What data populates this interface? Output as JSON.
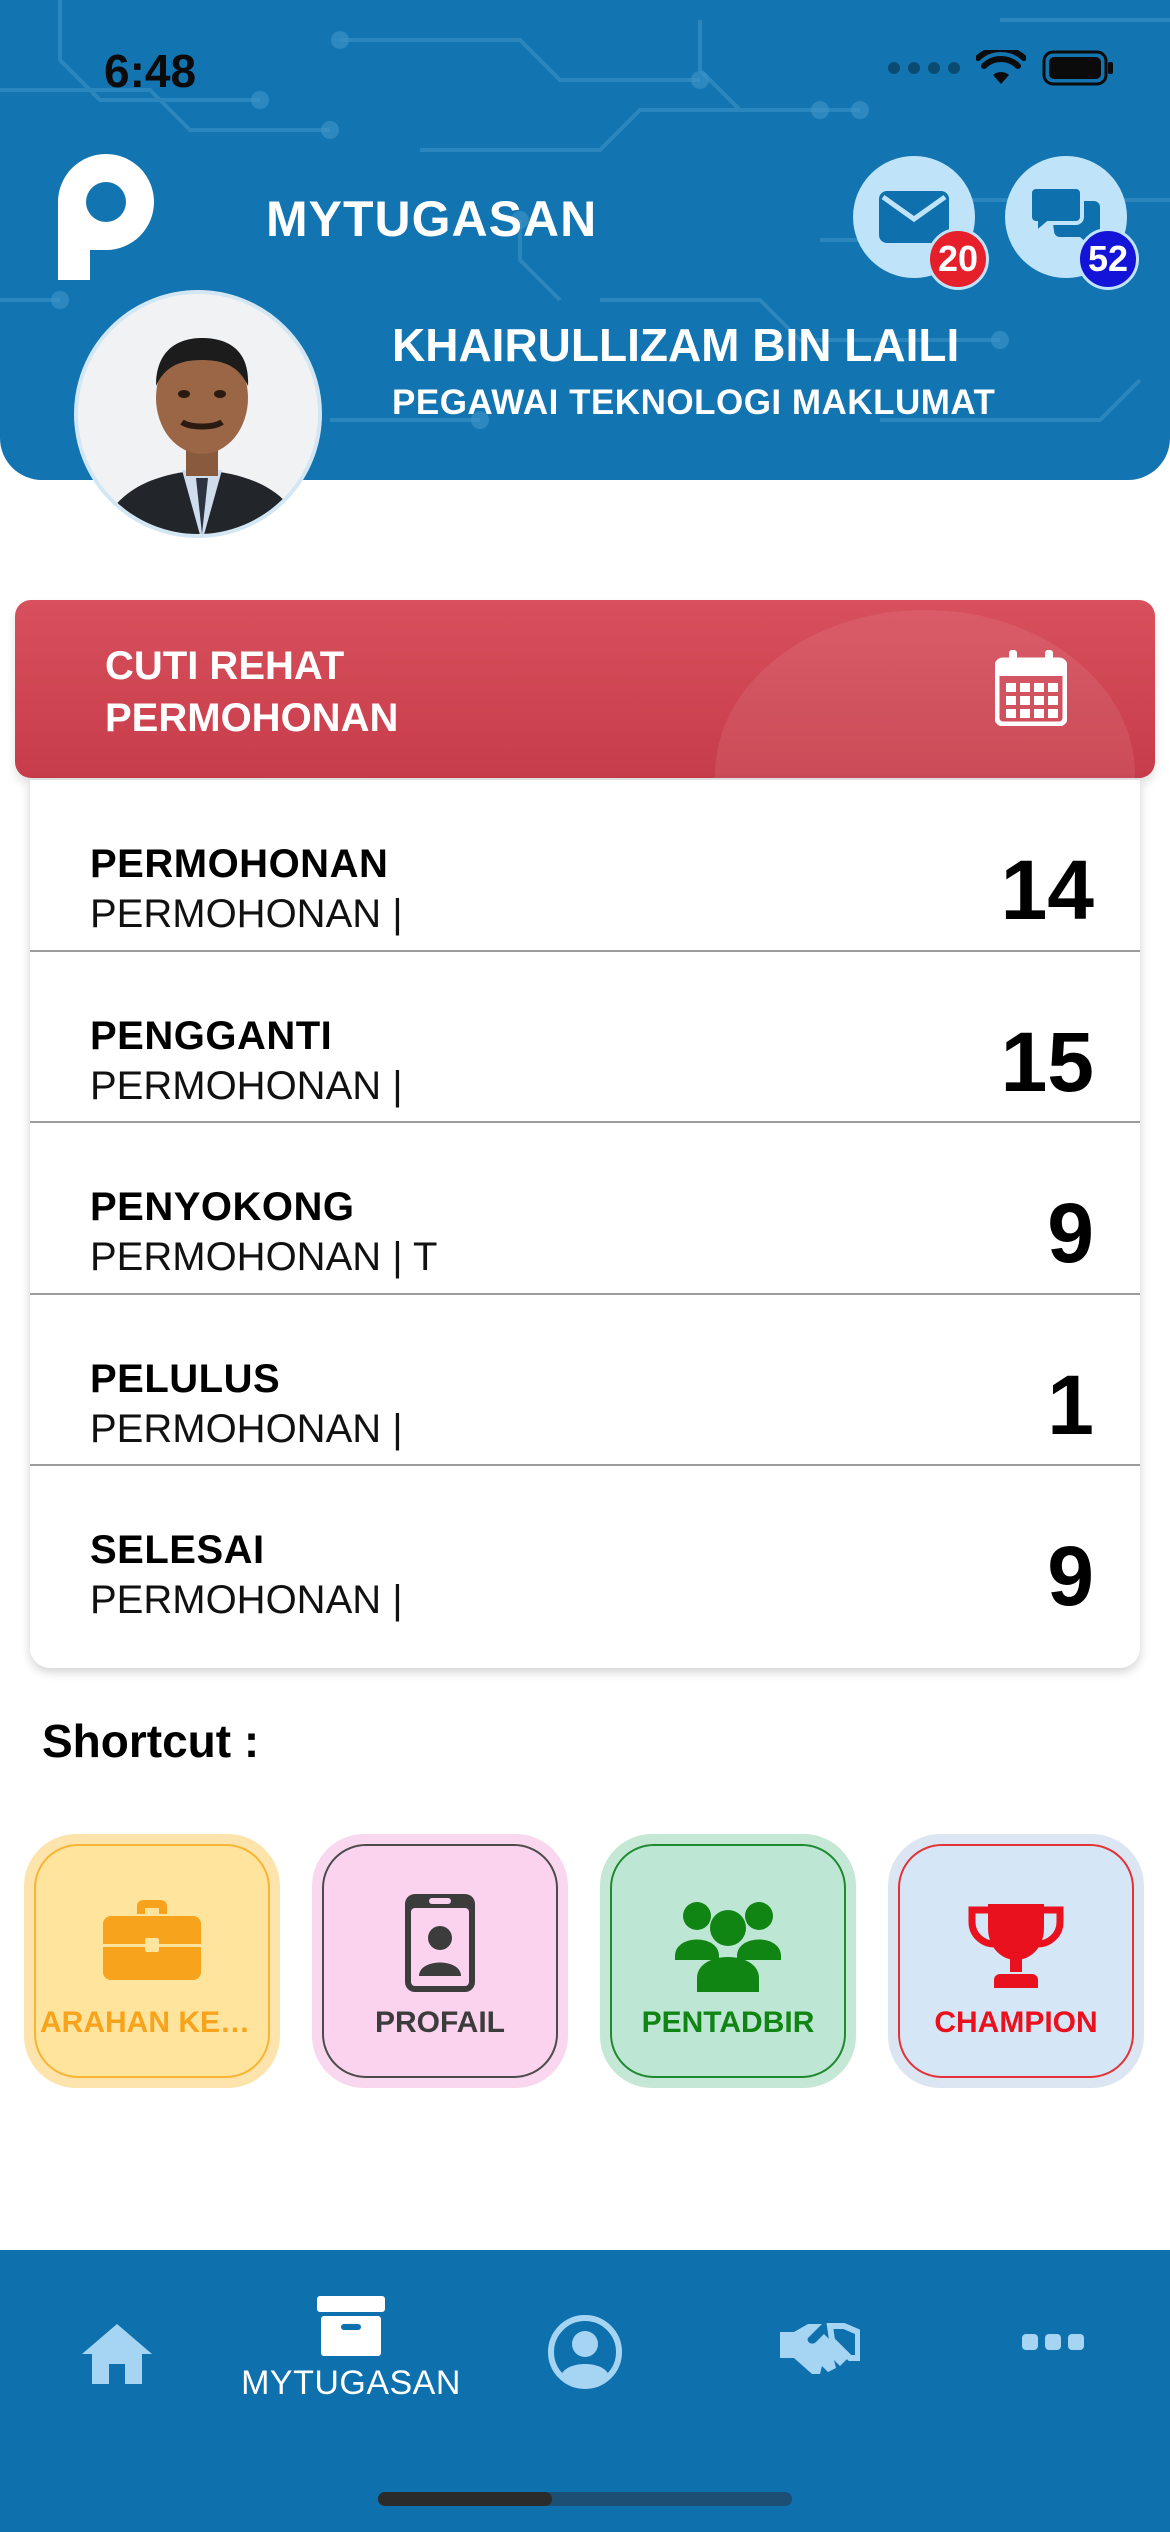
{
  "status_bar": {
    "time": "6:48"
  },
  "header": {
    "app_title": "MYTUGASAN",
    "user_name": "KHAIRULLIZAM BIN LAILI",
    "user_role": "PEGAWAI TEKNOLOGI MAKLUMAT",
    "mail_badge": "20",
    "chat_badge": "52",
    "colors": {
      "background": "#1274b0",
      "badge_red": "#e5202b",
      "badge_blue": "#1414d8"
    }
  },
  "leave_card": {
    "title_line1": "CUTI REHAT",
    "title_line2": "PERMOHONAN",
    "icon": "calendar-icon",
    "header_color": "#cf4653",
    "rows": [
      {
        "title": "PERMOHONAN",
        "subtitle": "PERMOHONAN |",
        "count": "14"
      },
      {
        "title": "PENGGANTI",
        "subtitle": "PERMOHONAN |",
        "count": "15"
      },
      {
        "title": "PENYOKONG",
        "subtitle": "PERMOHONAN | T",
        "count": "9"
      },
      {
        "title": "PELULUS",
        "subtitle": "PERMOHONAN |",
        "count": "1"
      },
      {
        "title": "SELESAI",
        "subtitle": "PERMOHONAN |",
        "count": "9"
      }
    ]
  },
  "shortcuts": {
    "label": "Shortcut :",
    "items": [
      {
        "label": "ARAHAN KER...",
        "icon": "briefcase-icon",
        "color": "#f7a41c"
      },
      {
        "label": "PROFAIL",
        "icon": "id-badge-icon",
        "color": "#3c3c3c"
      },
      {
        "label": "PENTADBIR",
        "icon": "users-icon",
        "color": "#108514"
      },
      {
        "label": "CHAMPION",
        "icon": "trophy-icon",
        "color": "#e8111d"
      }
    ]
  },
  "bottom_nav": {
    "items": [
      {
        "icon": "home-icon"
      },
      {
        "icon": "archive-icon",
        "label": "MYTUGASAN"
      },
      {
        "icon": "user-circle-icon"
      },
      {
        "icon": "handshake-icon"
      },
      {
        "icon": "more-icon"
      }
    ],
    "background": "#0e70ad"
  }
}
